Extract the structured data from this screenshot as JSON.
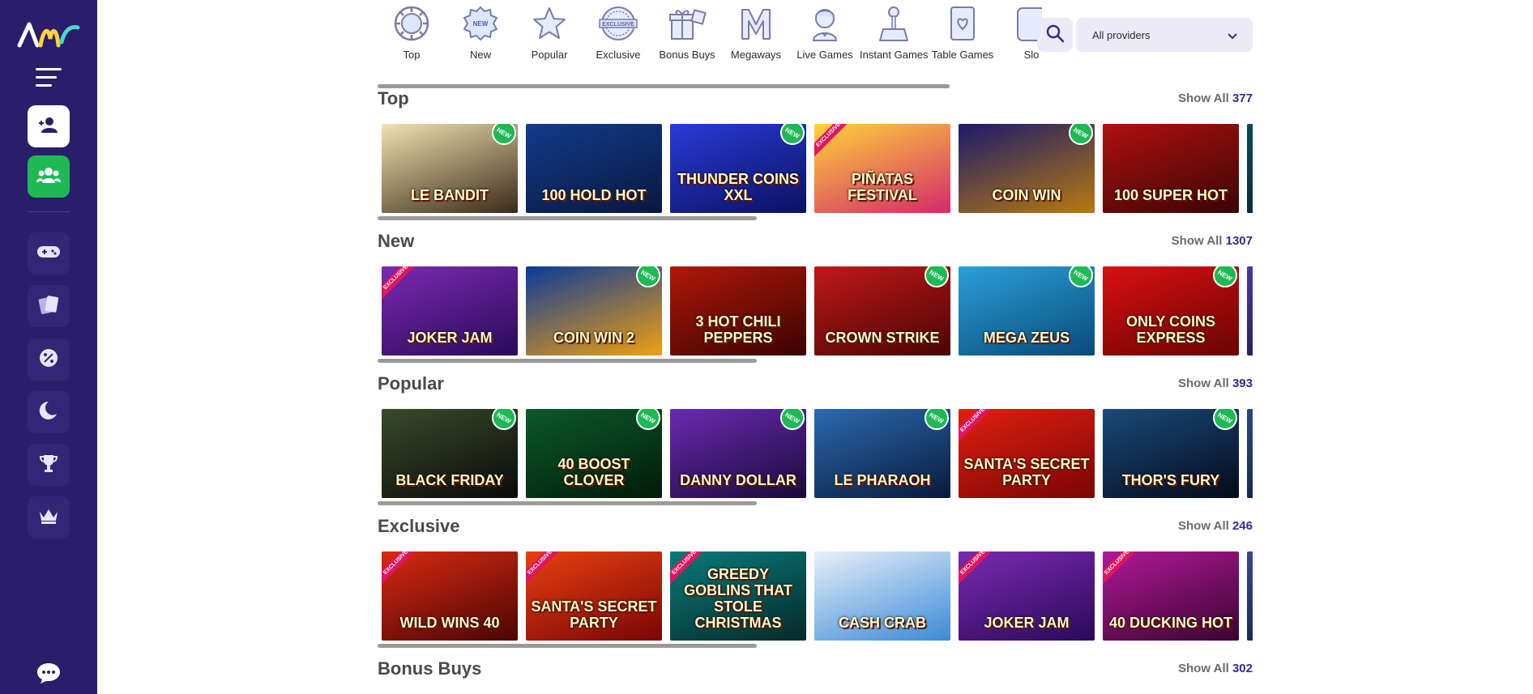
{
  "sidebar": {
    "logo_icon": "brand-logo-icon",
    "menu_icon": "hamburger-menu-icon",
    "buttons": [
      {
        "icon": "user-add-icon",
        "style": "white"
      },
      {
        "icon": "users-group-icon",
        "style": "green"
      },
      {
        "icon": "gamepad-icon",
        "style": "dark"
      },
      {
        "icon": "cards-icon",
        "style": "dark"
      },
      {
        "icon": "percent-badge-icon",
        "style": "dark"
      },
      {
        "icon": "moon-icon",
        "style": "dark"
      },
      {
        "icon": "trophy-icon",
        "style": "dark"
      },
      {
        "icon": "crown-icon",
        "style": "dark"
      }
    ],
    "chat_icon": "chat-bubble-icon"
  },
  "categories": [
    {
      "label": "Top",
      "icon": "top-chip-icon"
    },
    {
      "label": "New",
      "icon": "new-badge-icon"
    },
    {
      "label": "Popular",
      "icon": "star-icon"
    },
    {
      "label": "Exclusive",
      "icon": "exclusive-seal-icon"
    },
    {
      "label": "Bonus Buys",
      "icon": "gift-box-icon"
    },
    {
      "label": "Megaways",
      "icon": "megaways-m-icon"
    },
    {
      "label": "Live Games",
      "icon": "dealer-icon"
    },
    {
      "label": "Instant Games",
      "icon": "joystick-icon"
    },
    {
      "label": "Table Games",
      "icon": "playing-card-icon"
    },
    {
      "label": "Slo",
      "icon": "slot-machine-icon"
    }
  ],
  "search": {
    "icon": "search-icon"
  },
  "provider_filter": {
    "value": "All providers",
    "icon": "chevron-down-icon"
  },
  "show_all_label": "Show All",
  "sections": [
    {
      "title": "Top",
      "count": "377",
      "games": [
        {
          "name": "Le Bandit",
          "bg": [
            "#f2e2b0",
            "#3a2a1a"
          ],
          "badge": "new"
        },
        {
          "name": "100 Hold Hot",
          "bg": [
            "#123a8a",
            "#0a1840"
          ],
          "badge": ""
        },
        {
          "name": "Thunder Coins XXL",
          "bg": [
            "#2a3ad8",
            "#0a1260"
          ],
          "badge": "new"
        },
        {
          "name": "Piñatas Festival",
          "bg": [
            "#ffd23a",
            "#d22a6a"
          ],
          "badge": "exclusive"
        },
        {
          "name": "Coin Win",
          "bg": [
            "#1a1a6a",
            "#b87a10"
          ],
          "badge": "new"
        },
        {
          "name": "100 Super Hot",
          "bg": [
            "#b01010",
            "#3a0505"
          ],
          "badge": ""
        },
        {
          "name": "",
          "bg": [
            "#0a4a5a",
            "#05202a"
          ],
          "badge": ""
        }
      ]
    },
    {
      "title": "New",
      "count": "1307",
      "games": [
        {
          "name": "Joker Jam",
          "bg": [
            "#7a2ab0",
            "#2a0a5a"
          ],
          "badge": "exclusive"
        },
        {
          "name": "Coin Win 2",
          "bg": [
            "#0a3a9a",
            "#f0a010"
          ],
          "badge": "new"
        },
        {
          "name": "3 Hot Chili Peppers",
          "bg": [
            "#b01808",
            "#3a0303"
          ],
          "badge": ""
        },
        {
          "name": "Crown Strike",
          "bg": [
            "#c01818",
            "#4a0505"
          ],
          "badge": "new"
        },
        {
          "name": "Mega Zeus",
          "bg": [
            "#2aa0d8",
            "#0a4a7a"
          ],
          "badge": "new"
        },
        {
          "name": "Only Coins Express",
          "bg": [
            "#d81010",
            "#6a0303"
          ],
          "badge": "new"
        },
        {
          "name": "",
          "bg": [
            "#4a3aa0",
            "#1a103a"
          ],
          "badge": ""
        }
      ]
    },
    {
      "title": "Popular",
      "count": "393",
      "games": [
        {
          "name": "Black Friday",
          "bg": [
            "#3a4a2a",
            "#0a0a0a"
          ],
          "badge": "new"
        },
        {
          "name": "40 Boost Clover",
          "bg": [
            "#0a5a2a",
            "#031a0a"
          ],
          "badge": "new"
        },
        {
          "name": "Danny Dollar",
          "bg": [
            "#6a2ab0",
            "#1a0a3a"
          ],
          "badge": "new"
        },
        {
          "name": "Le Pharaoh",
          "bg": [
            "#2a6ab0",
            "#0a1a3a"
          ],
          "badge": "new"
        },
        {
          "name": "Santa's Secret Party",
          "bg": [
            "#e02010",
            "#7a0505"
          ],
          "badge": "exclusive"
        },
        {
          "name": "Thor's Fury",
          "bg": [
            "#1a4a7a",
            "#050a1a"
          ],
          "badge": "new"
        },
        {
          "name": "",
          "bg": [
            "#2a4a7a",
            "#0a1a3a"
          ],
          "badge": ""
        }
      ]
    },
    {
      "title": "Exclusive",
      "count": "246",
      "games": [
        {
          "name": "Wild Wins 40",
          "bg": [
            "#d82a10",
            "#4a0505"
          ],
          "badge": "exclusive"
        },
        {
          "name": "Santa's Secret Party",
          "bg": [
            "#e84010",
            "#7a0505"
          ],
          "badge": "exclusive"
        },
        {
          "name": "Greedy Goblins That Stole Christmas",
          "bg": [
            "#0a7a7a",
            "#052a2a"
          ],
          "badge": "exclusive"
        },
        {
          "name": "Cash Crab",
          "bg": [
            "#e8f0f8",
            "#3a8ad8"
          ],
          "badge": ""
        },
        {
          "name": "Joker Jam",
          "bg": [
            "#7a2ab0",
            "#2a0a5a"
          ],
          "badge": "exclusive"
        },
        {
          "name": "40 Ducking Hot",
          "bg": [
            "#b01898",
            "#3a0530"
          ],
          "badge": "exclusive"
        },
        {
          "name": "",
          "bg": [
            "#3a4a8a",
            "#0a1a3a"
          ],
          "badge": ""
        }
      ]
    },
    {
      "title": "Bonus Buys",
      "count": "302",
      "games": []
    }
  ],
  "colors": {
    "sidebar": "#2a1e6b",
    "accent_green": "#1db954",
    "count": "#3a2a8a",
    "exclusive_ribbon": "#e0155f"
  }
}
